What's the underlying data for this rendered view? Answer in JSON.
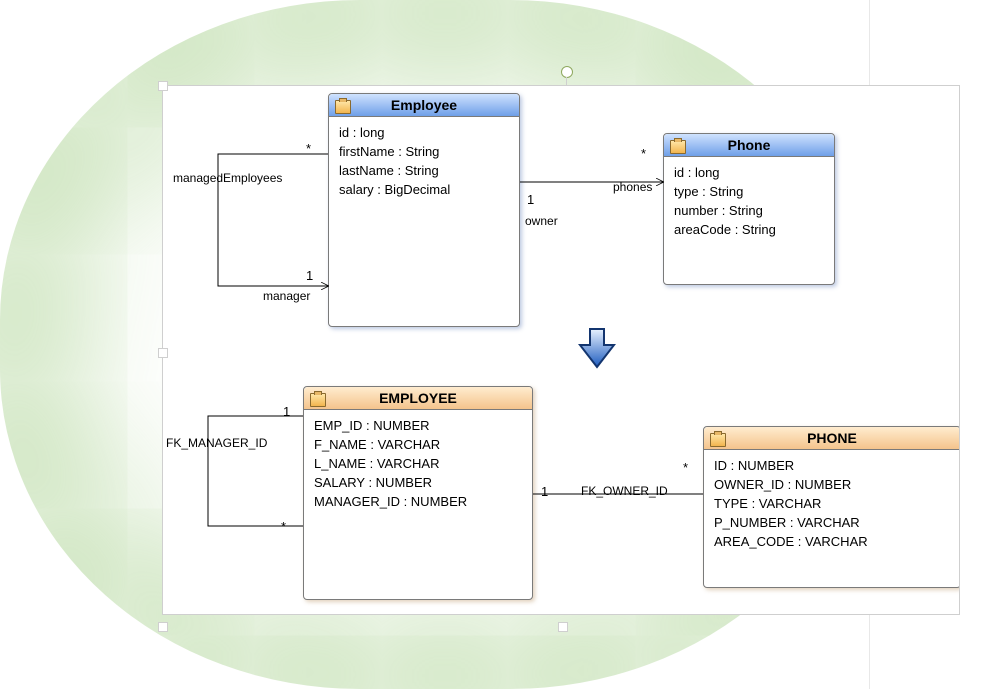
{
  "classes": {
    "employee": {
      "name": "Employee",
      "attrs": [
        "id : long",
        "firstName : String",
        "lastName : String",
        "salary : BigDecimal"
      ]
    },
    "phone": {
      "name": "Phone",
      "attrs": [
        "id : long",
        "type : String",
        "number : String",
        "areaCode : String"
      ]
    }
  },
  "tables": {
    "employee": {
      "name": "EMPLOYEE",
      "cols": [
        "EMP_ID : NUMBER",
        "F_NAME : VARCHAR",
        "L_NAME : VARCHAR",
        "SALARY : NUMBER",
        "MANAGER_ID : NUMBER"
      ]
    },
    "phone": {
      "name": "PHONE",
      "cols": [
        "ID : NUMBER",
        "OWNER_ID : NUMBER",
        "TYPE : VARCHAR",
        "P_NUMBER : VARCHAR",
        "AREA_CODE : VARCHAR"
      ]
    }
  },
  "rel": {
    "managedEmployees": "managedEmployees",
    "manager": "manager",
    "phones": "phones",
    "owner": "owner",
    "fkManager": "FK_MANAGER_ID",
    "fkOwner": "FK_OWNER_ID"
  },
  "mult": {
    "star": "*",
    "one": "1"
  }
}
